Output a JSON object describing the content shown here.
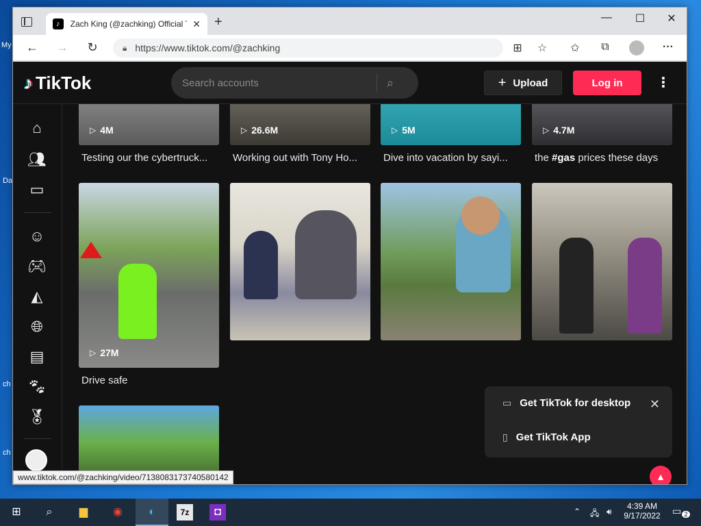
{
  "desktop": {
    "labels": [
      "My",
      "Da",
      "ch",
      "ch"
    ]
  },
  "browser": {
    "tab_title": "Zach King (@zachking) Official T",
    "tab_favicon": "♪",
    "url": "https://www.tiktok.com/@zachking",
    "status_url": "www.tiktok.com/@zachking/video/7138083173740580142"
  },
  "tiktok": {
    "logo_text": "TikTok",
    "search_placeholder": "Search accounts",
    "upload_label": "Upload",
    "login_label": "Log in"
  },
  "videos": [
    {
      "views": "4M",
      "caption": "Testing our the cybertruck..."
    },
    {
      "views": "26.6M",
      "caption": "Working out with Tony Ho..."
    },
    {
      "views": "5M",
      "caption": "Dive into vacation by sayi..."
    },
    {
      "views": "4.7M",
      "caption_pre": "the ",
      "caption_tag": "#gas",
      "caption_post": " prices these days"
    },
    {
      "views": "27M",
      "caption": "Drive safe"
    }
  ],
  "popup": {
    "desktop_label": "Get TikTok for desktop",
    "app_label": "Get TikTok App"
  },
  "taskbar": {
    "time": "4:39 AM",
    "date": "9/17/2022",
    "notification_count": "2",
    "sevenzip_label": "7z"
  },
  "colors": {
    "accent": "#fe2c55",
    "page_bg": "#121212"
  }
}
